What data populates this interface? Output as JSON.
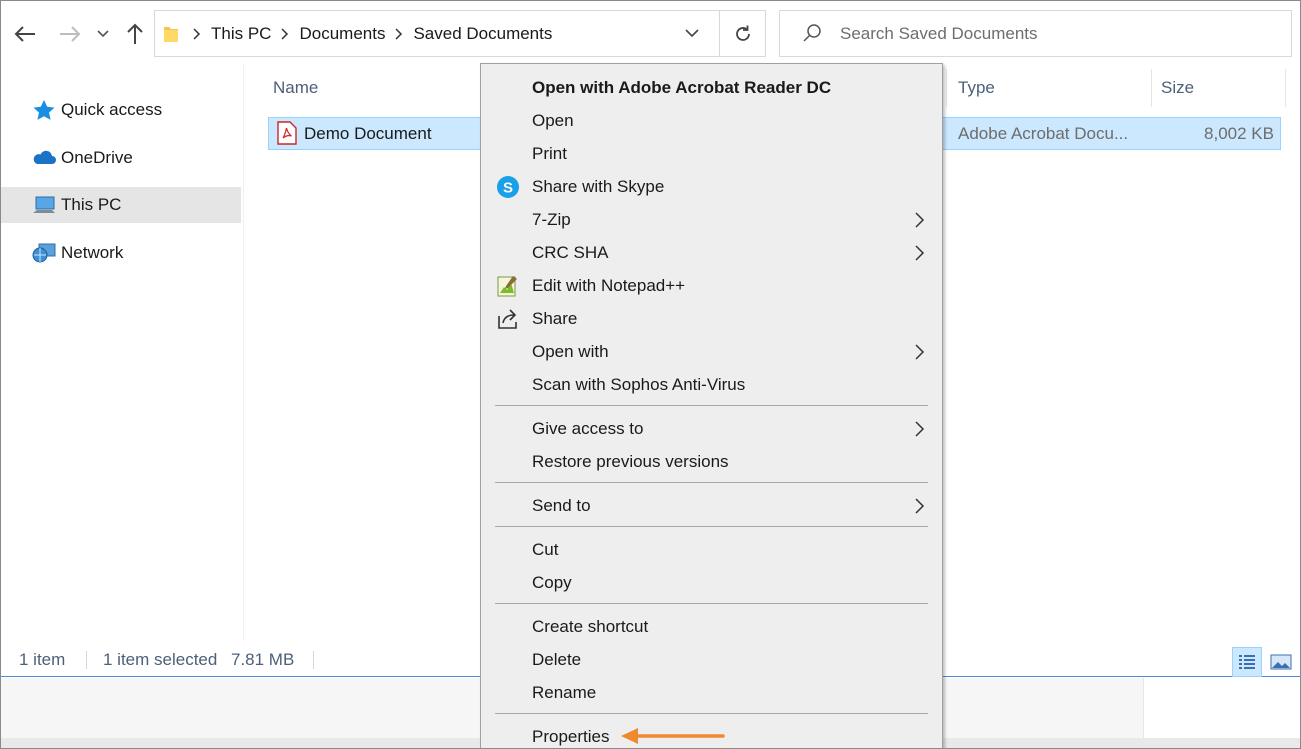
{
  "address": {
    "crumbs": [
      "This PC",
      "Documents",
      "Saved Documents"
    ]
  },
  "search": {
    "placeholder": "Search Saved Documents"
  },
  "sidebar": {
    "items": [
      {
        "label": "Quick access",
        "icon": "star-icon"
      },
      {
        "label": "OneDrive",
        "icon": "cloud-icon"
      },
      {
        "label": "This PC",
        "icon": "computer-icon",
        "selected": true
      },
      {
        "label": "Network",
        "icon": "network-icon"
      }
    ]
  },
  "columns": {
    "name": "Name",
    "type": "Type",
    "size": "Size"
  },
  "file": {
    "name": "Demo Document",
    "type": "Adobe Acrobat Docu...",
    "size": "8,002 KB",
    "icon": "pdf-file-icon"
  },
  "status": {
    "count": "1 item",
    "selected": "1 item selected",
    "selected_size": "7.81 MB"
  },
  "context_menu": {
    "open_default": "Open with Adobe Acrobat Reader DC",
    "open": "Open",
    "print": "Print",
    "share_skype": "Share with Skype",
    "zip": "7-Zip",
    "crc": "CRC SHA",
    "notepad": "Edit with Notepad++",
    "share": "Share",
    "open_with": "Open with",
    "sophos": "Scan with Sophos Anti-Virus",
    "give_access": "Give access to",
    "restore": "Restore previous versions",
    "send_to": "Send to",
    "cut": "Cut",
    "copy": "Copy",
    "create_shortcut": "Create shortcut",
    "delete": "Delete",
    "rename": "Rename",
    "properties": "Properties"
  },
  "colors": {
    "selection": "#cce8ff",
    "selection_border": "#99d1ff",
    "menu_bg": "#eeeeee",
    "callout_arrow": "#f0892e",
    "header_text": "#4c607a"
  }
}
